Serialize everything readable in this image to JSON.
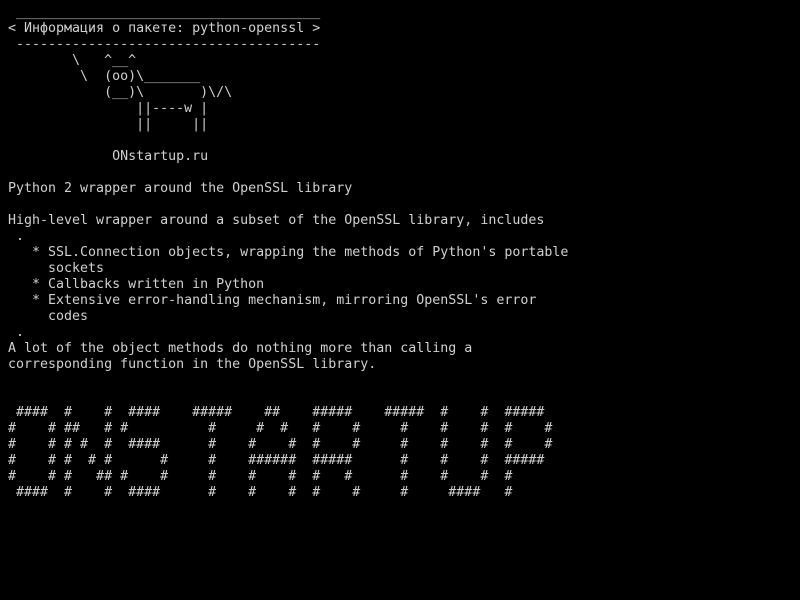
{
  "colors": {
    "background": "#000000",
    "text": "#d0d0d0"
  },
  "terminal": {
    "lines": [
      " ______________________________________",
      "< Информация о пакете: python-openssl >",
      " --------------------------------------",
      "        \\   ^__^",
      "         \\  (oo)\\_______",
      "            (__)\\       )\\/\\",
      "                ||----w |",
      "                ||     ||",
      "",
      "             ONstartup.ru",
      "",
      "Python 2 wrapper around the OpenSSL library",
      "",
      "High-level wrapper around a subset of the OpenSSL library, includes",
      " .",
      "   * SSL.Connection objects, wrapping the methods of Python's portable",
      "     sockets",
      "   * Callbacks written in Python",
      "   * Extensive error-handling mechanism, mirroring OpenSSL's error",
      "     codes",
      " .",
      "A lot of the object methods do nothing more than calling a",
      "corresponding function in the OpenSSL library.",
      "",
      "",
      " ####  #    #  ####    #####    ##    #####    #####  #    #  #####",
      "#    # ##   # #          #     #  #   #    #     #    #    #  #    #",
      "#    # # #  #  ####      #    #    #  #    #     #    #    #  #    #",
      "#    # #  # #      #     #    ######  #####      #    #    #  #####",
      "#    # #   ## #    #     #    #    #  #   #      #    #    #  #",
      " ####  #    #  ####      #    #    #  #    #     #     ####   #"
    ]
  }
}
